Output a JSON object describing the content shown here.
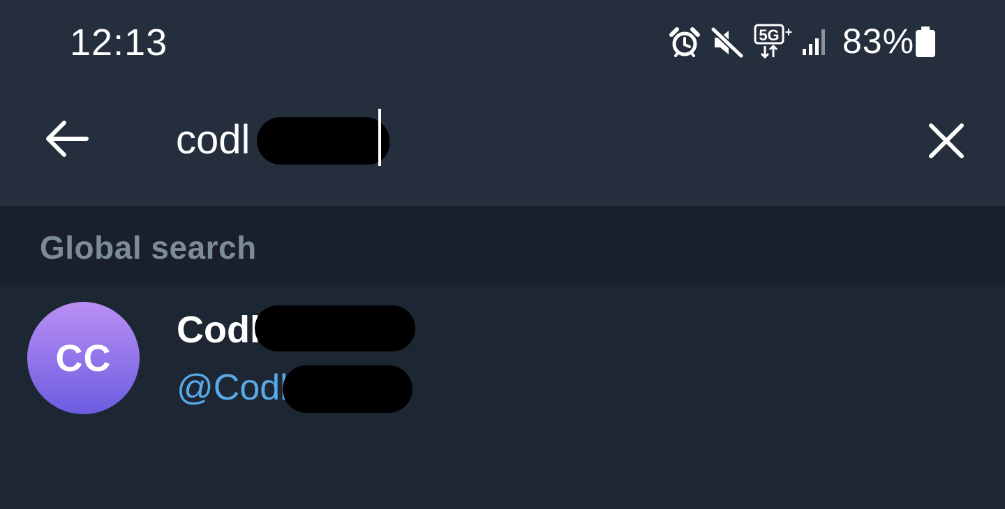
{
  "status_bar": {
    "time": "12:13",
    "battery_percent": "83%",
    "icons": [
      "alarm-icon",
      "muted-icon",
      "5g-icon",
      "signal-icon",
      "battery-icon"
    ]
  },
  "search": {
    "query": "codl"
  },
  "section": {
    "title": "Global search"
  },
  "results": [
    {
      "initials": "CC",
      "name": "Codl",
      "username": "@Codl"
    }
  ],
  "colors": {
    "background": "#1d2633",
    "toolbar": "#252e3d",
    "section_bg": "#19202b",
    "section_text": "#7d8b99",
    "username": "#5aa9e6",
    "avatar_top": "#b98ff3",
    "avatar_bottom": "#6c5ce0"
  }
}
